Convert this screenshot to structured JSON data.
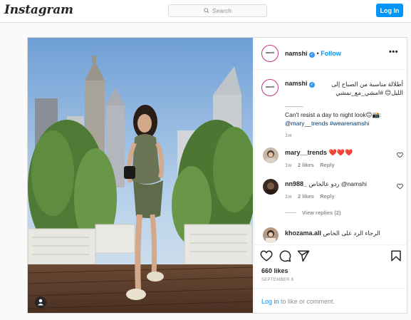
{
  "header": {
    "logo_text": "Instagram",
    "search_placeholder": "Search",
    "login_label": "Log In"
  },
  "post": {
    "author": "namshi",
    "follow_label": "Follow",
    "caption_arabic": "أطلالة مناسبة من الصباح إلى الليل😊 #امشي_مع_نمشي",
    "caption_separator": "———",
    "caption_english": "Can't resist a day to night look😊📸:",
    "caption_links": "@mary__trends #wearenamshi",
    "caption_age": "1w",
    "likes": "660 likes",
    "date": "SEPTEMBER 8",
    "login_link": "Log in",
    "login_suffix": " to like or comment."
  },
  "comments": [
    {
      "user": "mary__trends",
      "text": "❤️❤️❤️",
      "age": "1w",
      "likes": "2 likes",
      "reply": "Reply"
    },
    {
      "user": "nn988_",
      "text": "ردو عالخاص @namshi",
      "age": "1w",
      "likes": "2 likes",
      "reply": "Reply",
      "view_replies": "View replies (2)"
    },
    {
      "user": "khozama.all",
      "text": "الرجاء الرد على الخاص"
    }
  ],
  "colors": {
    "accent": "#0095f6",
    "border": "#dbdbdb",
    "text": "#262626",
    "muted": "#8e8e8e",
    "heart": "#ed4956"
  },
  "icons": [
    "search-icon",
    "verified-icon",
    "more-options-icon",
    "heart-icon",
    "comment-icon",
    "share-icon",
    "bookmark-icon",
    "user-tag-icon"
  ]
}
